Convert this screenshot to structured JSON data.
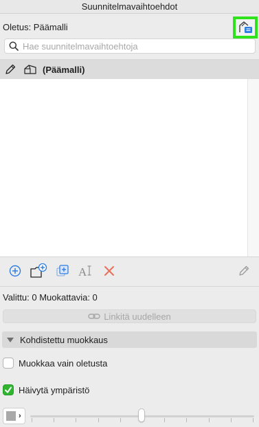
{
  "window": {
    "title": "Suunnitelmavaihtoehdot"
  },
  "default": {
    "label": "Oletus: Päämalli"
  },
  "search": {
    "placeholder": "Hae suunnitelmavaihtoehtoja",
    "value": ""
  },
  "list": {
    "items": [
      {
        "label": "(Päämalli)",
        "selected": true
      }
    ]
  },
  "toolbar": {
    "icons": [
      "add-option-icon",
      "add-folder-icon",
      "duplicate-icon",
      "rename-icon",
      "delete-icon",
      "edit-icon"
    ]
  },
  "status": {
    "text": "Valittu: 0 Muokattavia: 0"
  },
  "relink": {
    "label": "Linkitä uudelleen"
  },
  "focused_edit": {
    "title": "Kohdistettu muokkaus",
    "edit_default_only": {
      "label": "Muokkaa vain oletusta",
      "checked": false
    },
    "fade_surroundings": {
      "label": "Häivytä ympäristö",
      "checked": true
    },
    "fade_level": 0.5
  },
  "colors": {
    "accent": "#2f7de1",
    "delete": "#e8715a",
    "highlight": "#2ee31c",
    "check": "#2fb52f"
  }
}
